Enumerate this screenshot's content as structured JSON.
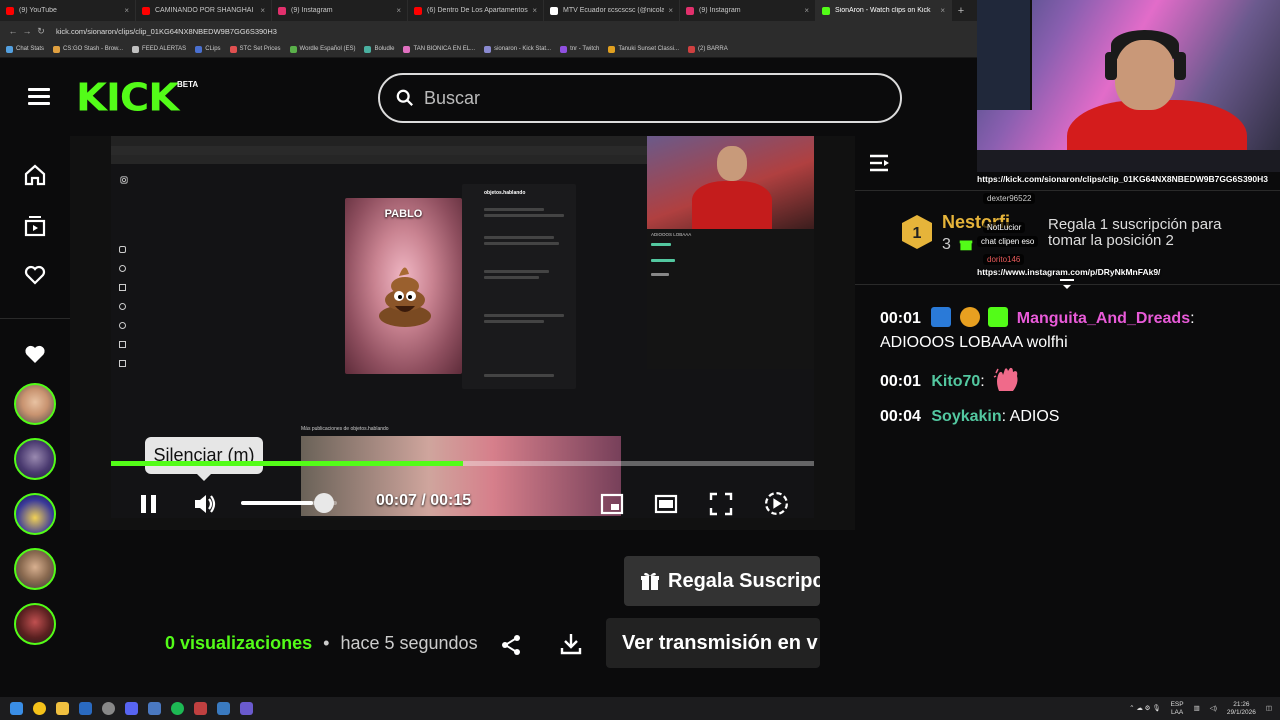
{
  "browser": {
    "tabs": [
      {
        "label": "(9) YouTube",
        "color": "#ff0000"
      },
      {
        "label": "CAMINANDO POR SHANGHAI",
        "color": "#ff0000"
      },
      {
        "label": "(9) Instagram",
        "color": "#e1306c"
      },
      {
        "label": "(6) Dentro De Los Apartamentos",
        "color": "#ff0000"
      },
      {
        "label": "MTV Ecuador ɛcscscsc (@nicolasd",
        "color": "#ffffff"
      },
      {
        "label": "(9) Instagram",
        "color": "#e1306c"
      },
      {
        "label": "SionAron - Watch clips on Kick",
        "color": "#53fc18",
        "active": true
      }
    ],
    "new_tab": "+",
    "url": "kick.com/sionaron/clips/clip_01KG64NX8NBEDW9B7GG6S390H3",
    "bookmarks": [
      "Chat Stats",
      "CS:GO Stash - Brow...",
      "FEED ALERTAS",
      "CLips",
      "STC Set Prices",
      "Wordle Español (ES)",
      "Boludle",
      "TAN BIONICA EN EL...",
      "sionaron - Kick Stat...",
      "tnr - Twitch",
      "Tanuki Sunset Classi...",
      "(2) BARRA"
    ]
  },
  "header": {
    "logo": "KICK",
    "beta": "BETA",
    "search_placeholder": "Buscar"
  },
  "player": {
    "tooltip": "Silenciar (m)",
    "progress": 0.5,
    "volume": 0.75,
    "time": "00:07 / 00:15",
    "embedded": {
      "post_title": "PABLO",
      "account": "objetos.hablando",
      "more_posts": "Más publicaciones de objetos.hablando",
      "chat_line": "ADIOOOS LOBAAA"
    }
  },
  "below": {
    "gift_button": "Regala Suscripc",
    "views_count": "0",
    "views_label": "visualizaciones",
    "views_sep": "•",
    "time_ago": "hace 5 segundos",
    "watch_button": "Ver transmisión en v"
  },
  "chat": {
    "leader": {
      "name": "Nestorfi",
      "count": "3",
      "rank": "1"
    },
    "gift_prompt": "Regala 1 suscripción para tomar la posición 2",
    "messages": [
      {
        "time": "00:01",
        "user": "Manguita_And_Dreads",
        "sep": ":",
        "text": "ADIOOOS LOBAAA wolfhi",
        "color": "#e85ad8"
      },
      {
        "time": "00:01",
        "user": "Kito70",
        "sep": ":",
        "text": "",
        "color": "#53c8a0"
      },
      {
        "time": "00:04",
        "user": "Soykakin",
        "sep": ":",
        "text": "ADIOS",
        "color": "#53c8a0"
      }
    ]
  },
  "overlay": {
    "url1": "https://kick.com/sionaron/clips/clip_01KG64NX8NBEDW9B7GG6S390H3",
    "tag1": "dexter96522",
    "tag2": "NotLucior",
    "tag3": "chat clipen eso",
    "tag4": "dorito146",
    "url2": "https://www.instagram.com/p/DRyNkMnFAk9/"
  },
  "taskbar": {
    "lang": "ESP\nLAA",
    "time": "21:26",
    "date": "29/1/2026"
  }
}
